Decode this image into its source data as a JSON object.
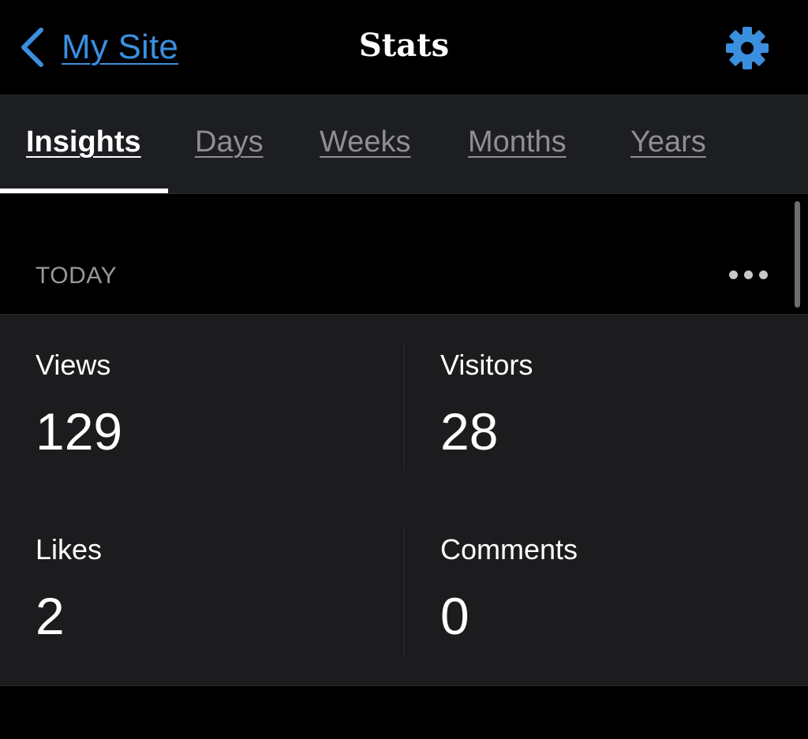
{
  "navbar": {
    "back_label": "My Site",
    "title": "Stats",
    "back_icon": "chevron-left-icon",
    "settings_icon": "gear-icon"
  },
  "tabs": [
    {
      "label": "Insights",
      "active": true
    },
    {
      "label": "Days",
      "active": false
    },
    {
      "label": "Weeks",
      "active": false
    },
    {
      "label": "Months",
      "active": false
    },
    {
      "label": "Years",
      "active": false
    }
  ],
  "section": {
    "title": "TODAY",
    "more_icon": "ellipsis-icon"
  },
  "stats": {
    "views": {
      "label": "Views",
      "value": "129"
    },
    "visitors": {
      "label": "Visitors",
      "value": "28"
    },
    "likes": {
      "label": "Likes",
      "value": "2"
    },
    "comments": {
      "label": "Comments",
      "value": "0"
    }
  },
  "colors": {
    "accent": "#3b8fdf",
    "background": "#000000",
    "card": "#1c1c1e",
    "tab_inactive": "#8e8e93"
  }
}
